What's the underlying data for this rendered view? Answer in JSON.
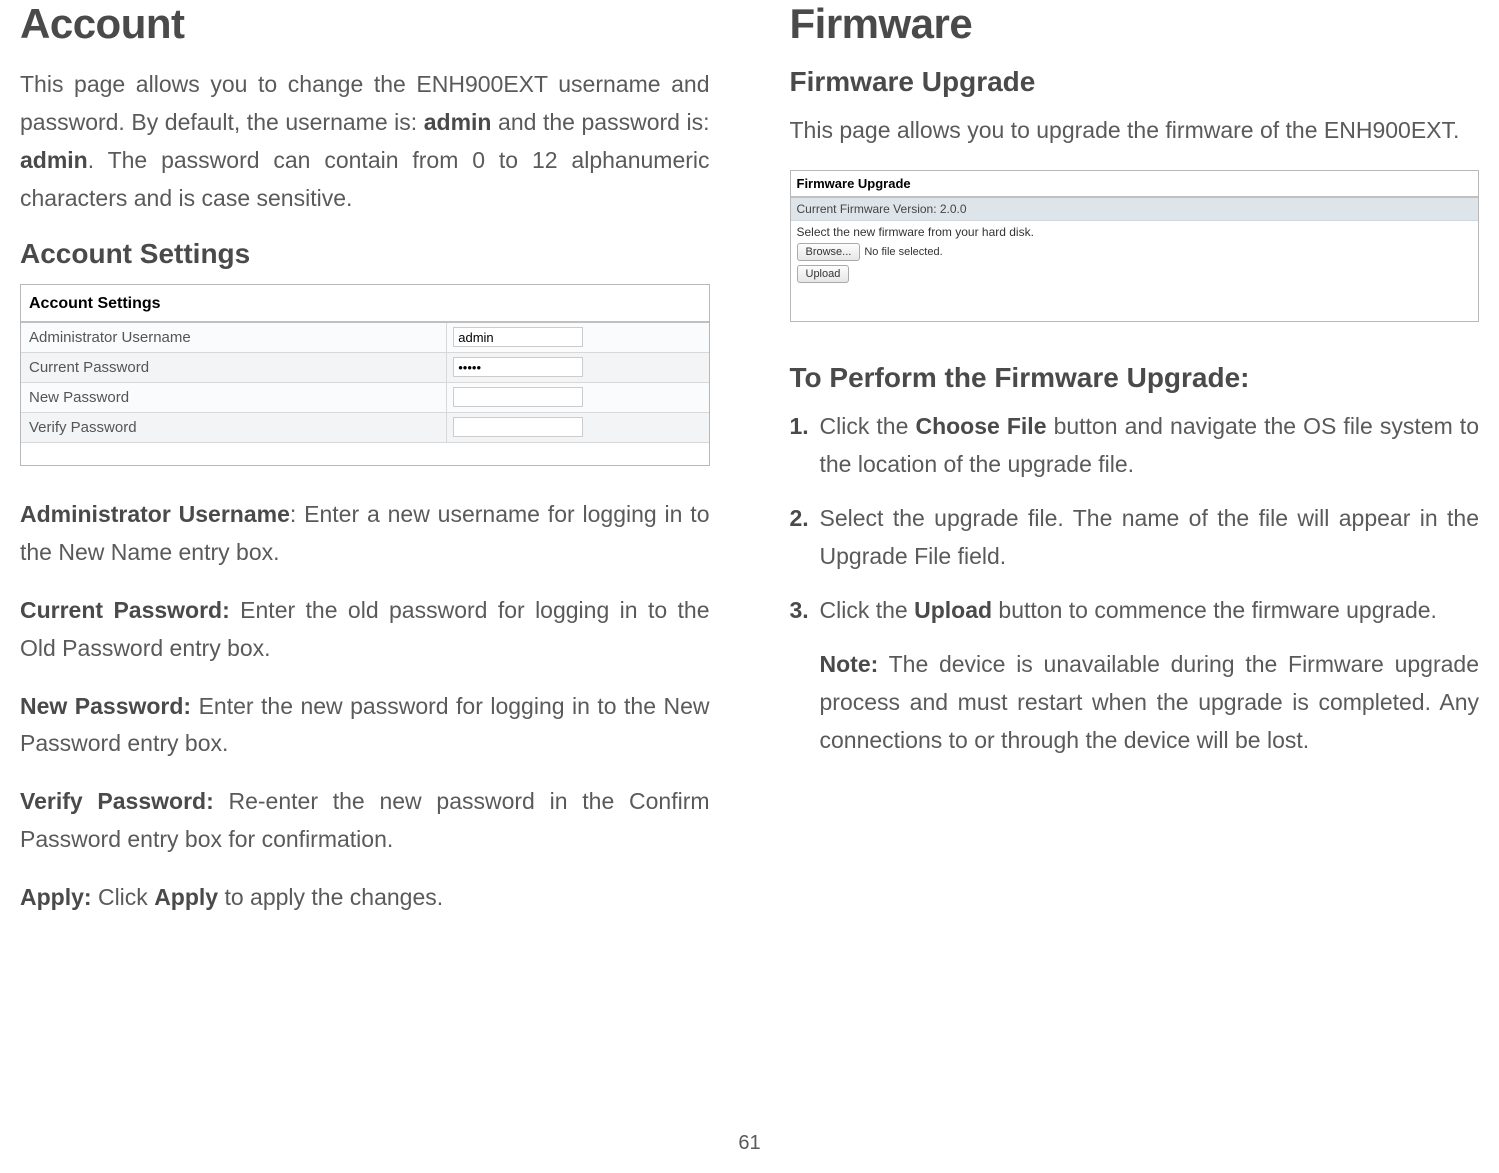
{
  "left": {
    "title": "Account",
    "intro_parts": {
      "p1": "This page allows you to change the ENH900EXT username and password. By default, the username is: ",
      "b1": "admin",
      "p2": " and the password is: ",
      "b2": "admin",
      "p3": ". The password can contain from 0 to 12 alphanumeric characters and is case sensitive."
    },
    "settings_heading": "Account Settings",
    "table": {
      "title": "Account Settings",
      "rows": [
        {
          "label": "Administrator Username",
          "value": "admin",
          "type": "text"
        },
        {
          "label": "Current Password",
          "value": "•••••",
          "type": "password"
        },
        {
          "label": "New Password",
          "value": "",
          "type": "password"
        },
        {
          "label": "Verify Password",
          "value": "",
          "type": "password"
        }
      ]
    },
    "defs": {
      "admin_user_label": "Administrator Username",
      "admin_user_text": ": Enter a new username for logging in to the New Name entry box.",
      "current_pw_label": "Current Password:",
      "current_pw_text": " Enter the old password for logging in to the Old Password entry box.",
      "new_pw_label": "New Password:",
      "new_pw_text": " Enter the new password for logging in to the New Password entry box.",
      "verify_pw_label": "Verify Password:",
      "verify_pw_text": " Re-enter the new password in the Confirm Password entry box for confirmation.",
      "apply_label": "Apply:",
      "apply_text1": " Click ",
      "apply_bold": "Apply",
      "apply_text2": " to apply the changes."
    }
  },
  "right": {
    "title": "Firmware",
    "upgrade_heading": "Firmware Upgrade",
    "intro": "This page allows you to upgrade the firmware of the ENH900EXT.",
    "box": {
      "header": "Firmware Upgrade",
      "version": "Current Firmware Version: 2.0.0",
      "instruction": "Select the new firmware from your hard disk.",
      "browse_btn": "Browse...",
      "no_file": "No file selected.",
      "upload_btn": "Upload"
    },
    "perform_heading": "To Perform the Firmware Upgrade:",
    "steps": {
      "s1_num": "1.",
      "s1_a": "Click the ",
      "s1_bold": "Choose File",
      "s1_b": " button and navigate the OS file system to the location of the upgrade file.",
      "s2_num": "2.",
      "s2": "Select the upgrade file. The name of the file will appear in the Upgrade File field.",
      "s3_num": "3.",
      "s3_a": "Click the ",
      "s3_bold": "Upload",
      "s3_b": " button to commence the firmware upgrade."
    },
    "note_label": "Note:",
    "note_text": " The device is unavailable during the Firmware upgrade process and must restart when the upgrade is completed. Any connections to or through the device will be lost."
  },
  "page_number": "61"
}
